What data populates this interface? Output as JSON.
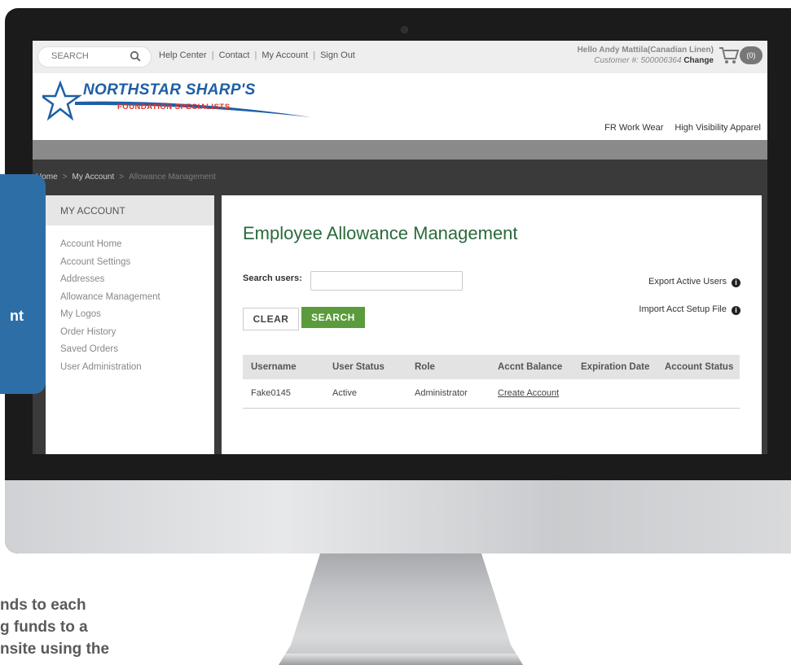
{
  "colors": {
    "brand_blue": "#1e5fa6",
    "brand_red": "#e0362c",
    "accent_green": "#5a9b3b",
    "heading_green": "#2a6a3c",
    "panel_blue": "#2e6ea6"
  },
  "topbar": {
    "search_placeholder": "SEARCH",
    "links": [
      "Help Center",
      "Contact",
      "My Account",
      "Sign Out"
    ],
    "greeting": "Hello Andy Mattila(Canadian Linen)",
    "customer_label": "Customer #:",
    "customer_number": "500006364",
    "change_label": "Change",
    "cart_count": "(0)"
  },
  "logo": {
    "brand": "NORTHSTAR SHARP'S",
    "tagline": "FOUNDATION SPECIALISTS"
  },
  "nav": {
    "items": [
      "FR Work Wear",
      "High Visibility Apparel"
    ]
  },
  "breadcrumb": {
    "items": [
      "Home",
      "My Account",
      "Allowance Management"
    ]
  },
  "sidebar": {
    "title": "MY ACCOUNT",
    "items": [
      "Account Home",
      "Account Settings",
      "Addresses",
      "Allowance Management",
      "My Logos",
      "Order History",
      "Saved Orders",
      "User Administration"
    ]
  },
  "main": {
    "title": "Employee Allowance Management",
    "search_label": "Search users:",
    "search_value": "",
    "clear_label": "CLEAR",
    "search_button": "SEARCH",
    "export_label": "Export Active Users",
    "import_label": "Import Acct Setup File",
    "info_glyph": "i"
  },
  "table": {
    "headers": [
      "Username",
      "User Status",
      "Role",
      "Accnt Balance",
      "Expiration Date",
      "Account Status"
    ],
    "rows": [
      {
        "username": "Fake0145",
        "status": "Active",
        "role": "Administrator",
        "balance": "Create Account",
        "expiration": "",
        "account_status": ""
      }
    ]
  },
  "overlay": {
    "panel_text": "nt"
  },
  "caption": {
    "lines": [
      "nds to each",
      "g funds to a",
      "nsite using the"
    ]
  }
}
